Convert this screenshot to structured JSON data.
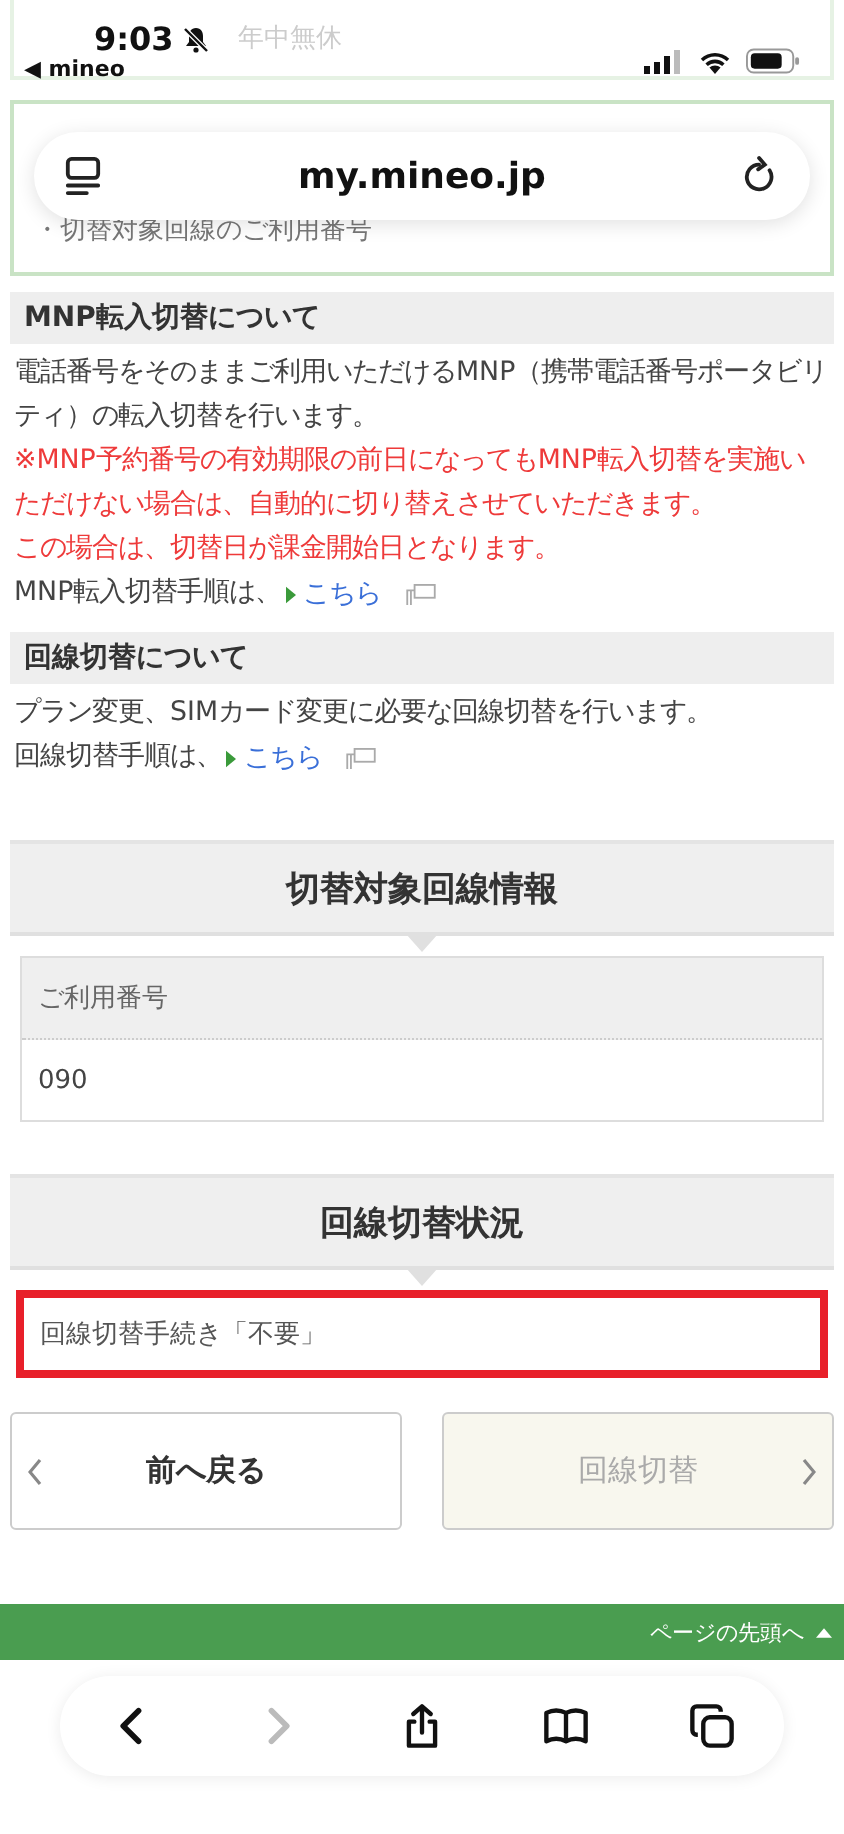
{
  "status_bar": {
    "time": "9:03",
    "back_app": "◀ mineo"
  },
  "url_bar": {
    "url": "my.mineo.jp"
  },
  "notice": {
    "hours": "年中無休"
  },
  "target_box": {
    "item": "・切替対象回線のご利用番号"
  },
  "sections": [
    {
      "heading": "MNP転入切替について",
      "paragraphs": [
        {
          "kind": "normal",
          "text": "電話番号をそのままご利用いただけるMNP（携帯電話番号ポータビリティ）の転入切替を行います。"
        },
        {
          "kind": "warning",
          "text": "※MNP予約番号の有効期限の前日になってもMNP転入切替を実施いただけない場合は、自動的に切り替えさせていただきます。"
        },
        {
          "kind": "warning",
          "text": "この場合は、切替日が課金開始日となります。"
        },
        {
          "kind": "link",
          "text": "MNP転入切替手順は、",
          "link": "こちら"
        }
      ]
    },
    {
      "heading": "回線切替について",
      "paragraphs": [
        {
          "kind": "normal",
          "text": "プラン変更、SIMカード変更に必要な回線切替を行います。"
        },
        {
          "kind": "link",
          "text": "回線切替手順は、",
          "link": "こちら"
        }
      ]
    }
  ],
  "info_panel": {
    "title": "切替対象回線情報",
    "label": "ご利用番号",
    "value": "090"
  },
  "status_panel": {
    "title": "回線切替状況",
    "status": "回線切替手続き「不要」",
    "highlighted": true
  },
  "buttons": [
    {
      "kind": "back",
      "label": "前へ戻る",
      "disabled": false
    },
    {
      "kind": "next",
      "label": "回線切替",
      "disabled": true
    }
  ],
  "page_top": {
    "label": "ページの先頭へ"
  },
  "toolbar": [
    {
      "kind": "back",
      "disabled": false
    },
    {
      "kind": "forward",
      "disabled": true
    },
    {
      "kind": "share",
      "disabled": false
    },
    {
      "kind": "bookmarks",
      "disabled": false
    },
    {
      "kind": "tabs",
      "disabled": false
    }
  ]
}
